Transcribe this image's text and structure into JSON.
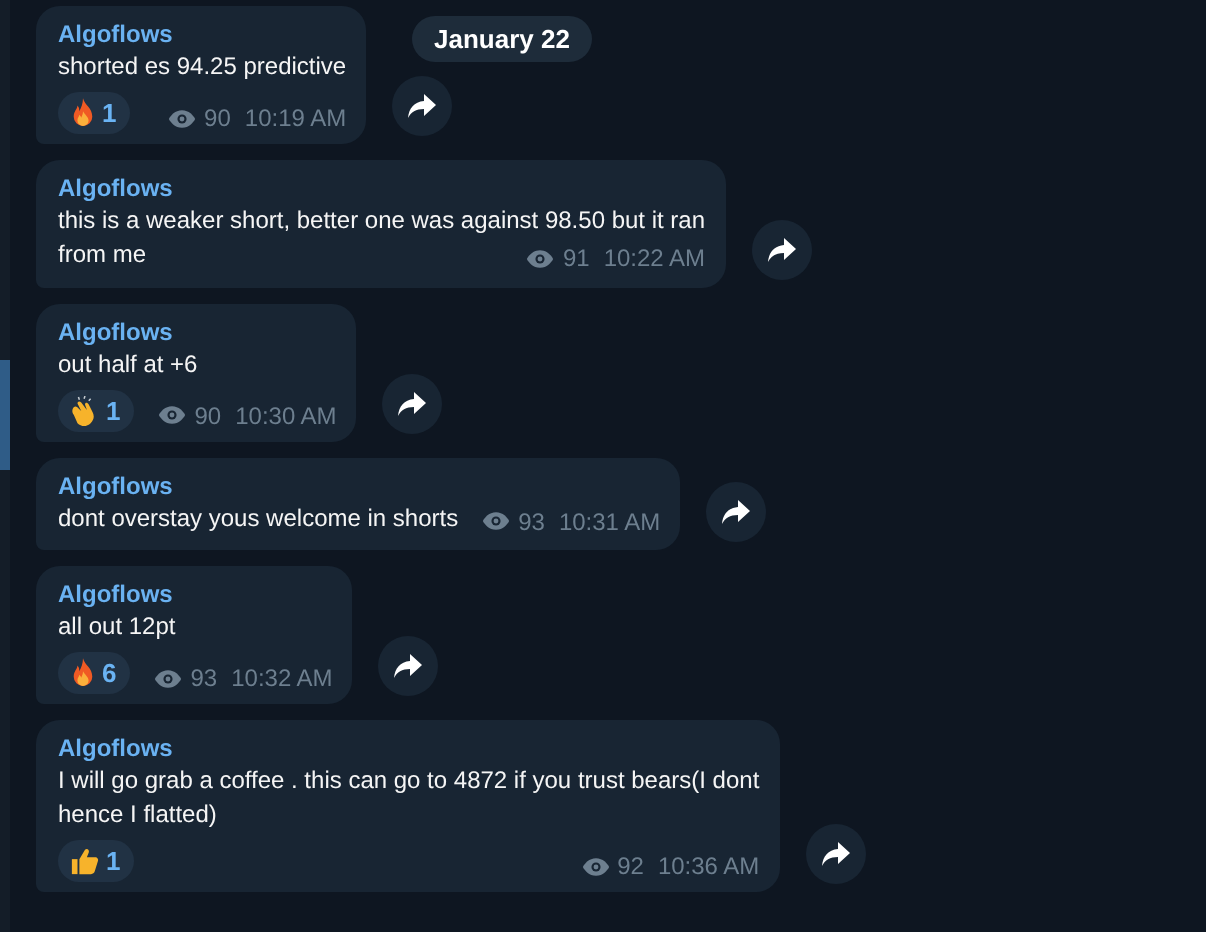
{
  "date_badge": "January 22",
  "messages": [
    {
      "sender": "Algoflows",
      "text": "shorted es 94.25 predictive",
      "reactions": [
        {
          "kind": "fire",
          "count": "1"
        }
      ],
      "views": "90",
      "time": "10:19 AM"
    },
    {
      "sender": "Algoflows",
      "text": "this is a weaker short, better one was against 98.50 but it ran\nfrom me",
      "views": "91",
      "time": "10:22 AM"
    },
    {
      "sender": "Algoflows",
      "text": "out half at +6",
      "reactions": [
        {
          "kind": "clap",
          "count": "1"
        }
      ],
      "views": "90",
      "time": "10:30 AM"
    },
    {
      "sender": "Algoflows",
      "text": "dont overstay yous welcome in shorts",
      "views": "93",
      "time": "10:31 AM"
    },
    {
      "sender": "Algoflows",
      "text": "all out 12pt",
      "reactions": [
        {
          "kind": "fire",
          "count": "6"
        }
      ],
      "views": "93",
      "time": "10:32 AM"
    },
    {
      "sender": "Algoflows",
      "text": "I will go grab a coffee . this can go to 4872 if you trust bears(I dont\nhence I flatted)",
      "reactions": [
        {
          "kind": "thumbs_up",
          "count": "1"
        }
      ],
      "views": "92",
      "time": "10:36 AM"
    }
  ]
}
